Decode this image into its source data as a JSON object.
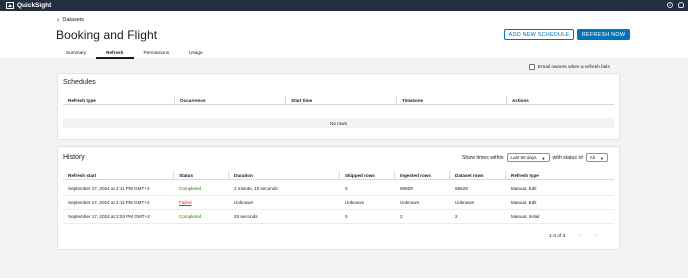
{
  "app": {
    "name": "QuickSight"
  },
  "topbar": {
    "help_icon": "help-icon",
    "user_icon": "user-icon"
  },
  "breadcrumb": {
    "back_label": "Datasets"
  },
  "page": {
    "title": "Booking and Flight"
  },
  "actions": {
    "add_schedule": "ADD NEW SCHEDULE",
    "refresh_now": "REFRESH NOW"
  },
  "tabs": [
    {
      "label": "Summary",
      "active": false
    },
    {
      "label": "Refresh",
      "active": true
    },
    {
      "label": "Permissions",
      "active": false
    },
    {
      "label": "Usage",
      "active": false
    }
  ],
  "email_option": {
    "label": "Email owners when a refresh fails",
    "checked": false
  },
  "schedules": {
    "title": "Schedules",
    "columns": [
      "Refresh type",
      "Occurrence",
      "Start time",
      "Timezone",
      "Actions"
    ],
    "empty_text": "No rows"
  },
  "history": {
    "title": "History",
    "filter_label_1": "Show times within",
    "filter_range": "Last 90 days",
    "filter_label_2": "with status of",
    "filter_status": "All",
    "columns": [
      "Refresh start",
      "Status",
      "Duration",
      "Skipped rows",
      "Ingested rows",
      "Dataset rows",
      "Refresh type"
    ],
    "rows": [
      {
        "start": "September 17, 2024 at 2:11 PM GMT+2",
        "status": "Completed",
        "duration": "1 minute, 10 seconds",
        "skipped": "0",
        "ingested": "69628",
        "dataset": "69628",
        "type": "Manual, Edit"
      },
      {
        "start": "September 17, 2024 at 2:11 PM GMT+2",
        "status": "Failed",
        "duration": "Unknown",
        "skipped": "Unknown",
        "ingested": "Unknown",
        "dataset": "Unknown",
        "type": "Manual, Edit"
      },
      {
        "start": "September 17, 2024 at 2:04 PM GMT+2",
        "status": "Completed",
        "duration": "33 seconds",
        "skipped": "0",
        "ingested": "2",
        "dataset": "2",
        "type": "Manual, Initial"
      }
    ],
    "pagination": "1-3 of 3"
  },
  "colors": {
    "accent": "#0073bb",
    "topbar": "#232f3e",
    "success": "#1d8102",
    "error": "#d13212"
  }
}
